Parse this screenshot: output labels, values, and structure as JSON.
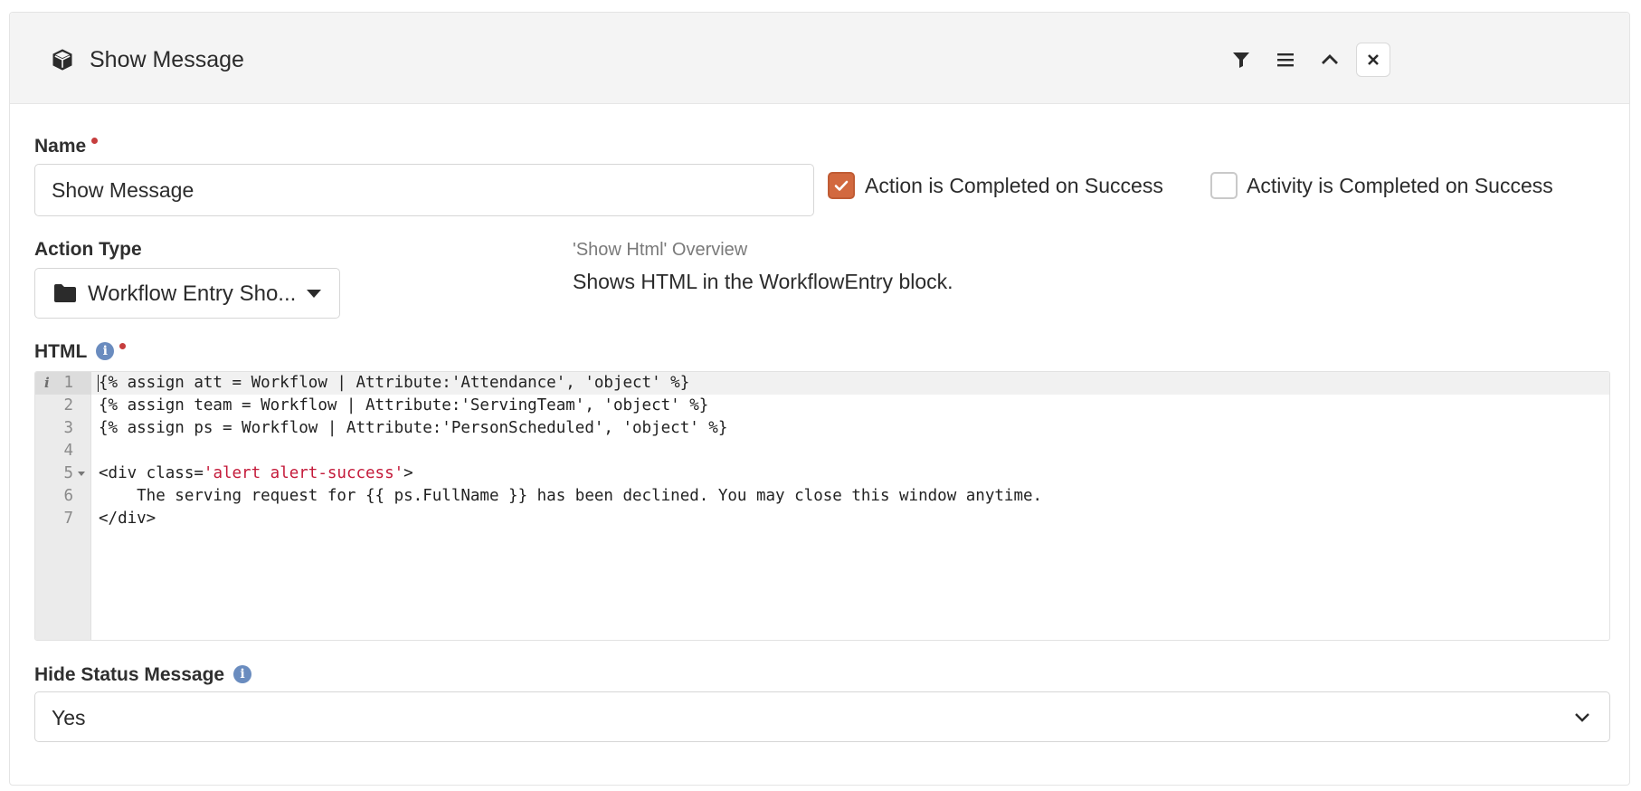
{
  "header": {
    "title": "Show Message",
    "icon": "cube-icon",
    "actions": [
      "filter-icon",
      "menu-icon",
      "chevron-up-icon",
      "close-icon"
    ]
  },
  "form": {
    "name": {
      "label": "Name",
      "value": "Show Message"
    },
    "action_completed": {
      "label": "Action is Completed on Success",
      "checked": true
    },
    "activity_completed": {
      "label": "Activity is Completed on Success",
      "checked": false
    },
    "action_type": {
      "label": "Action Type",
      "value": "Workflow Entry Sho...",
      "icon": "folder-icon"
    },
    "overview": {
      "title": "'Show Html' Overview",
      "description": "Shows HTML in the WorkflowEntry block."
    },
    "html": {
      "label": "HTML",
      "info_glyph": "i",
      "gutter_marker": "i",
      "lines": [
        {
          "num": "1",
          "parts": [
            {
              "t": "{% assign att = Workflow | Attribute:'Attendance', 'object' %}"
            }
          ]
        },
        {
          "num": "2",
          "parts": [
            {
              "t": "{% assign team = Workflow | Attribute:'ServingTeam', 'object' %}"
            }
          ]
        },
        {
          "num": "3",
          "parts": [
            {
              "t": "{% assign ps = Workflow | Attribute:'PersonScheduled', 'object' %}"
            }
          ]
        },
        {
          "num": "4",
          "parts": [
            {
              "t": ""
            }
          ]
        },
        {
          "num": "5",
          "parts": [
            {
              "t": "<div class="
            },
            {
              "t": "'alert alert-success'",
              "s": true
            },
            {
              "t": ">"
            }
          ],
          "fold": true
        },
        {
          "num": "6",
          "parts": [
            {
              "t": "    The serving request for {{ ps.FullName }} has been declined. You may close this window anytime."
            }
          ]
        },
        {
          "num": "7",
          "parts": [
            {
              "t": "</div>"
            }
          ]
        }
      ]
    },
    "hide_status": {
      "label": "Hide Status Message",
      "info_glyph": "i",
      "value": "Yes"
    }
  },
  "colors": {
    "accent": "#d2693f",
    "required": "#c63d3d",
    "info": "#6a8cbf",
    "code_string": "#c41a3a"
  }
}
